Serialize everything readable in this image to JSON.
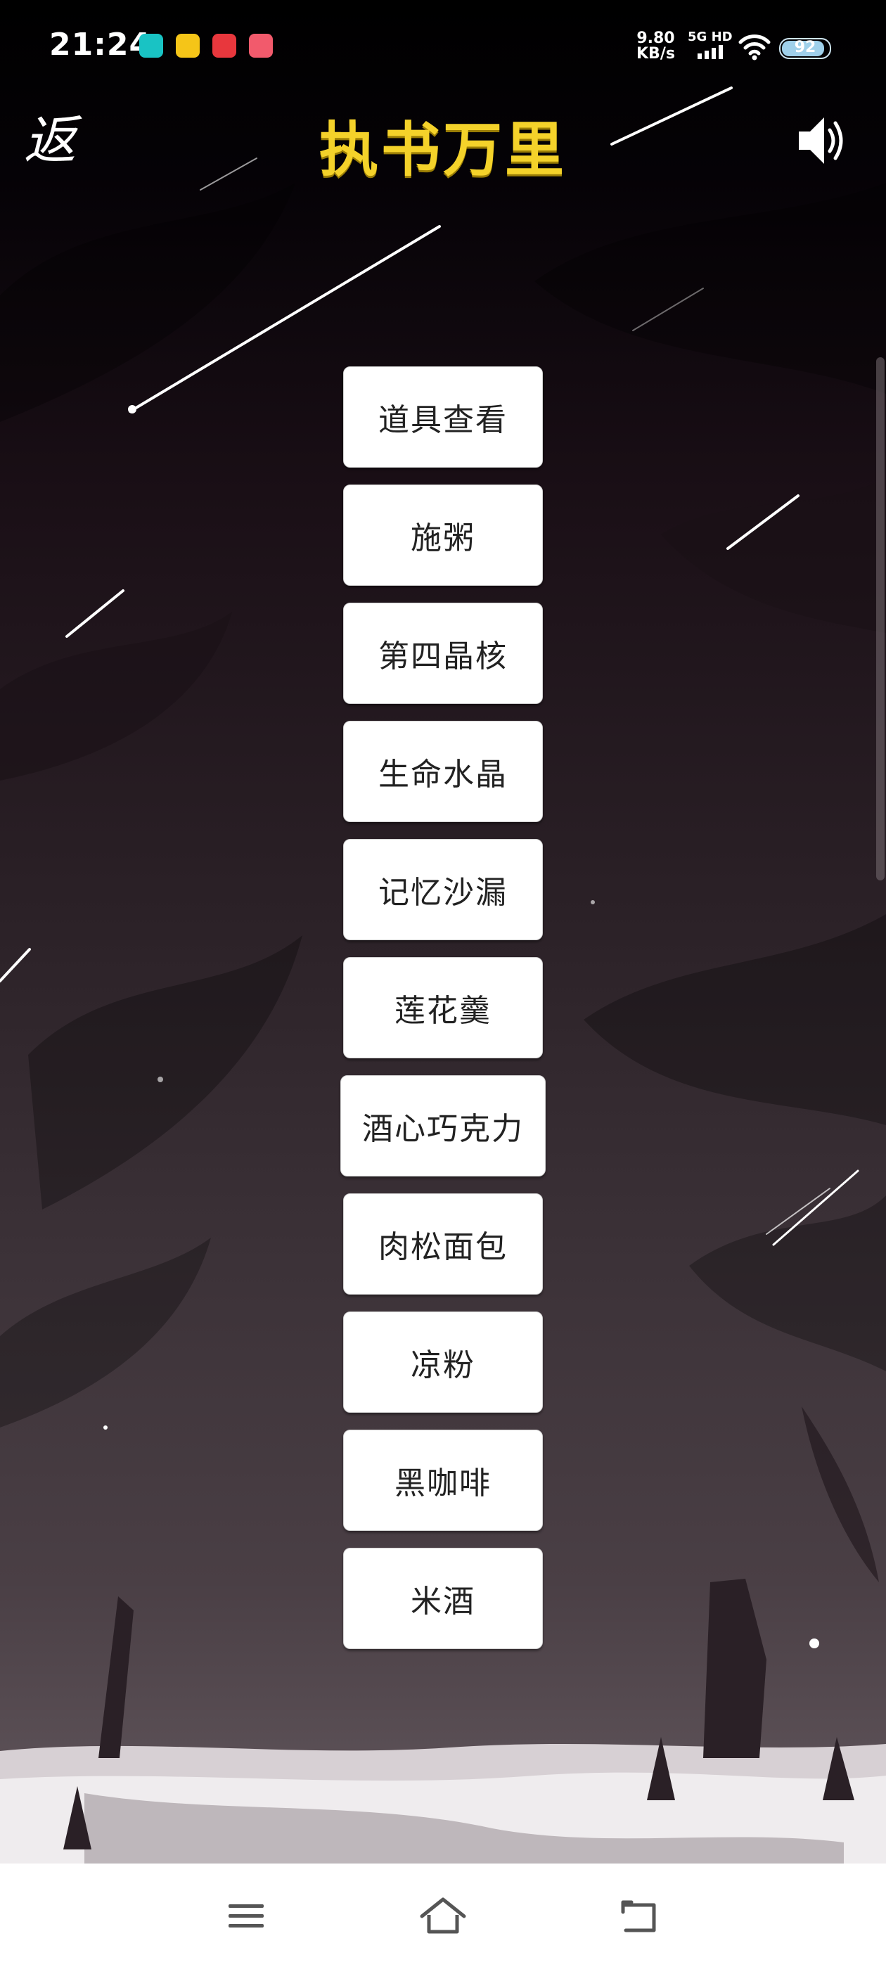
{
  "status_bar": {
    "time": "21:24",
    "net_speed_value": "9.80",
    "net_speed_unit": "KB/s",
    "network_type": "5G HD",
    "battery_percent": "92",
    "battery_level": 0.92,
    "app_icons": [
      {
        "name": "taptap-app-icon",
        "color": "#19c3c4"
      },
      {
        "name": "yellow-app-icon",
        "color": "#f5c518"
      },
      {
        "name": "red-app-icon",
        "color": "#e8373d"
      },
      {
        "name": "gallery-app-icon",
        "color": "#f25a6c"
      }
    ]
  },
  "header": {
    "back_label": "返",
    "title": "执书万里",
    "sound_icon": "speaker-sound-icon"
  },
  "items": [
    {
      "label": "道具查看"
    },
    {
      "label": "施粥"
    },
    {
      "label": "第四晶核"
    },
    {
      "label": "生命水晶"
    },
    {
      "label": "记忆沙漏"
    },
    {
      "label": "莲花羹"
    },
    {
      "label": "酒心巧克力"
    },
    {
      "label": "肉松面包"
    },
    {
      "label": "凉粉"
    },
    {
      "label": "黑咖啡"
    },
    {
      "label": "米酒"
    }
  ],
  "nav_bar": {
    "menu_icon": "menu-icon",
    "home_icon": "home-icon",
    "back_icon": "back-icon"
  },
  "colors": {
    "title": "#f4d22a",
    "button_bg": "#ffffff",
    "button_text": "#222222"
  }
}
